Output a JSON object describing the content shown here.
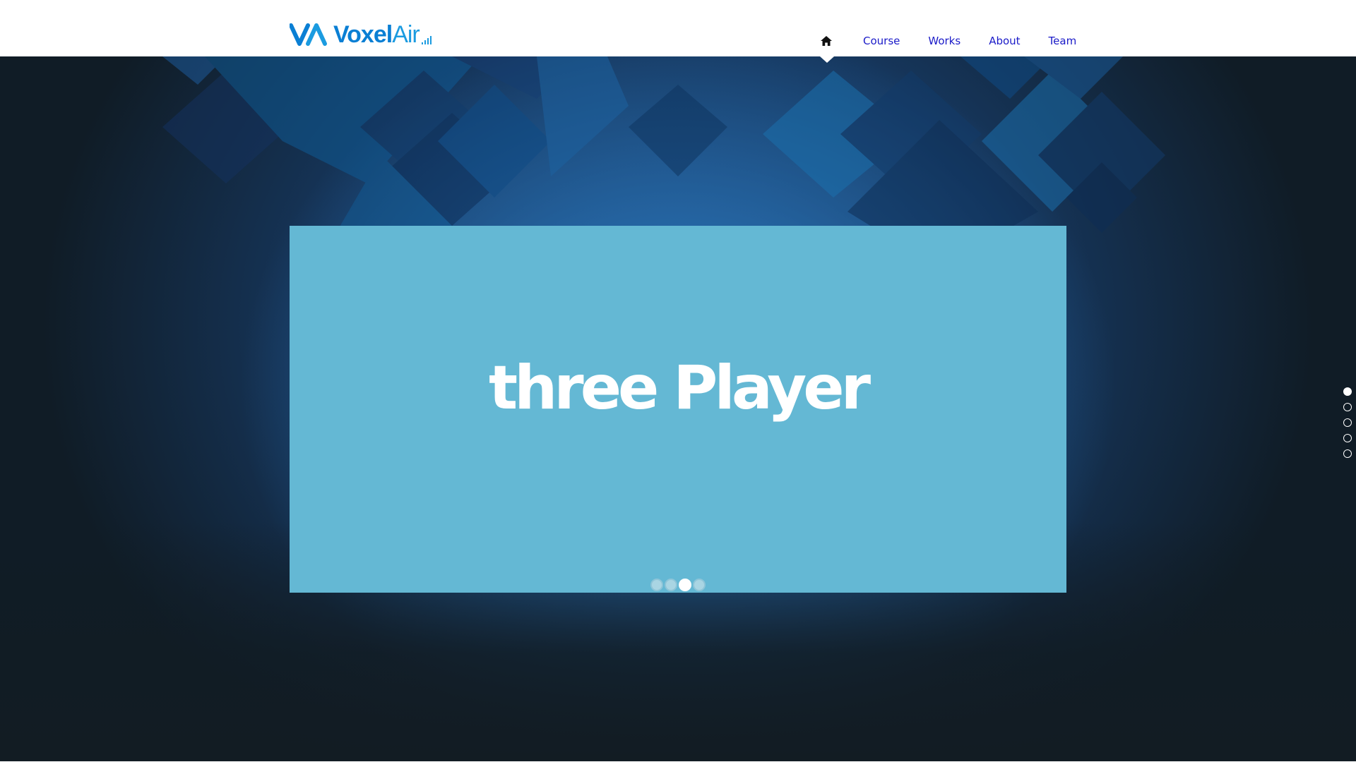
{
  "brand": {
    "name_bold": "Voxel",
    "name_light": "Air",
    "logo_icon": "voxelair-logo-icon",
    "colors": {
      "primary": "#0a7fd4",
      "nav_link": "#1a1ac8",
      "slide_bg": "#64b8d4"
    }
  },
  "nav": {
    "home_icon": "home-icon",
    "items": [
      {
        "label": "Course"
      },
      {
        "label": "Works"
      },
      {
        "label": "About"
      },
      {
        "label": "Team"
      }
    ]
  },
  "slider": {
    "title": "three Player",
    "dots": [
      {
        "state": "inactive"
      },
      {
        "state": "inactive"
      },
      {
        "state": "active"
      },
      {
        "state": "inactive"
      }
    ],
    "active_index": 3
  },
  "section_pager": {
    "count": 5,
    "active_index": 1
  }
}
